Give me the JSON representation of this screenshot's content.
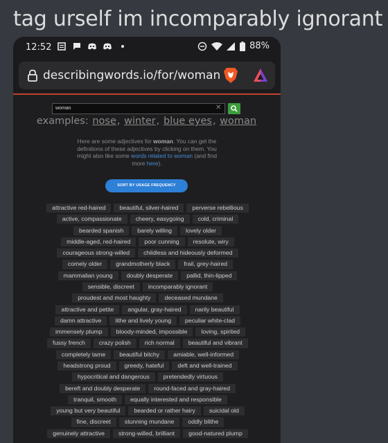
{
  "caption": "tag urself im incomparably ignorant",
  "status_bar": {
    "time": "12:52",
    "battery": "88%",
    "left_icons": [
      "notes-icon",
      "chat-icon",
      "discord-icon",
      "discord-icon",
      "dot-icon"
    ],
    "right_icons": [
      "do-not-disturb-icon",
      "wifi-icon",
      "signal-icon",
      "battery-icon"
    ]
  },
  "browser": {
    "url": "describingwords.io/for/woman",
    "accent_color": "#c0442e"
  },
  "search": {
    "value": "woman",
    "clear_glyph": "✕"
  },
  "examples": {
    "label": "examples:",
    "items": [
      "nose",
      "winter",
      "blue eyes",
      "woman"
    ]
  },
  "intro": {
    "t1": "Here are some adjectives for ",
    "bold": "woman",
    "t2": ". You can get the definitions of these adjectives by clicking on them. You might also like some ",
    "link1": "words related to woman",
    "t3": " (and find more ",
    "link2": "here",
    "t4": ")."
  },
  "sort_button": "SORT BY USAGE FREQUENCY",
  "word_rows": [
    [
      "attractive red-haired",
      "beautiful, silver-haired",
      "perverse rebellious"
    ],
    [
      "active, compassionate",
      "cheery, easygoing",
      "cold, criminal"
    ],
    [
      "bearded spanish",
      "barely willing",
      "lovely older"
    ],
    [
      "middle-aged, red-haired",
      "poor cunning",
      "resolute, wiry"
    ],
    [
      "courageous strong-willed",
      "childless and hideously deformed"
    ],
    [
      "comely older",
      "grandmotherly black",
      "frail, grey-haired"
    ],
    [
      "mammalian young",
      "doubly desperate",
      "pallid, thin-lipped"
    ],
    [
      "sensible, discreet",
      "incomparably ignorant"
    ],
    [
      "proudest and most haughty",
      "deceased mundane"
    ],
    [
      "attractive and petite",
      "angular, gray-haired",
      "narily beautiful"
    ],
    [
      "damn attractive",
      "lithe and lively young",
      "peculiar white-clad"
    ],
    [
      "immensely plump",
      "bloody-minded, impossible",
      "loving, spirited"
    ],
    [
      "fussy french",
      "crazy polish",
      "rich normal",
      "beautiful and vibrant"
    ],
    [
      "completely tame",
      "beautiful bitchy",
      "amiable, well-informed"
    ],
    [
      "headstrong proud",
      "greedy, hateful",
      "deft and well-trained"
    ],
    [
      "hypocritical and dangerous",
      "pretendedly virtuous"
    ],
    [
      "bereft and doubly desperate",
      "round-faced and gray-haired"
    ],
    [
      "tranquil, smooth",
      "equally interested and responsible"
    ],
    [
      "young but very beautiful",
      "bearded or rather hairy",
      "suicidal old"
    ],
    [
      "fine, discreet",
      "stunning mundane",
      "oddly blithe"
    ],
    [
      "genuinely attractive",
      "strong-willed, brilliant",
      "good-natured plump"
    ]
  ]
}
